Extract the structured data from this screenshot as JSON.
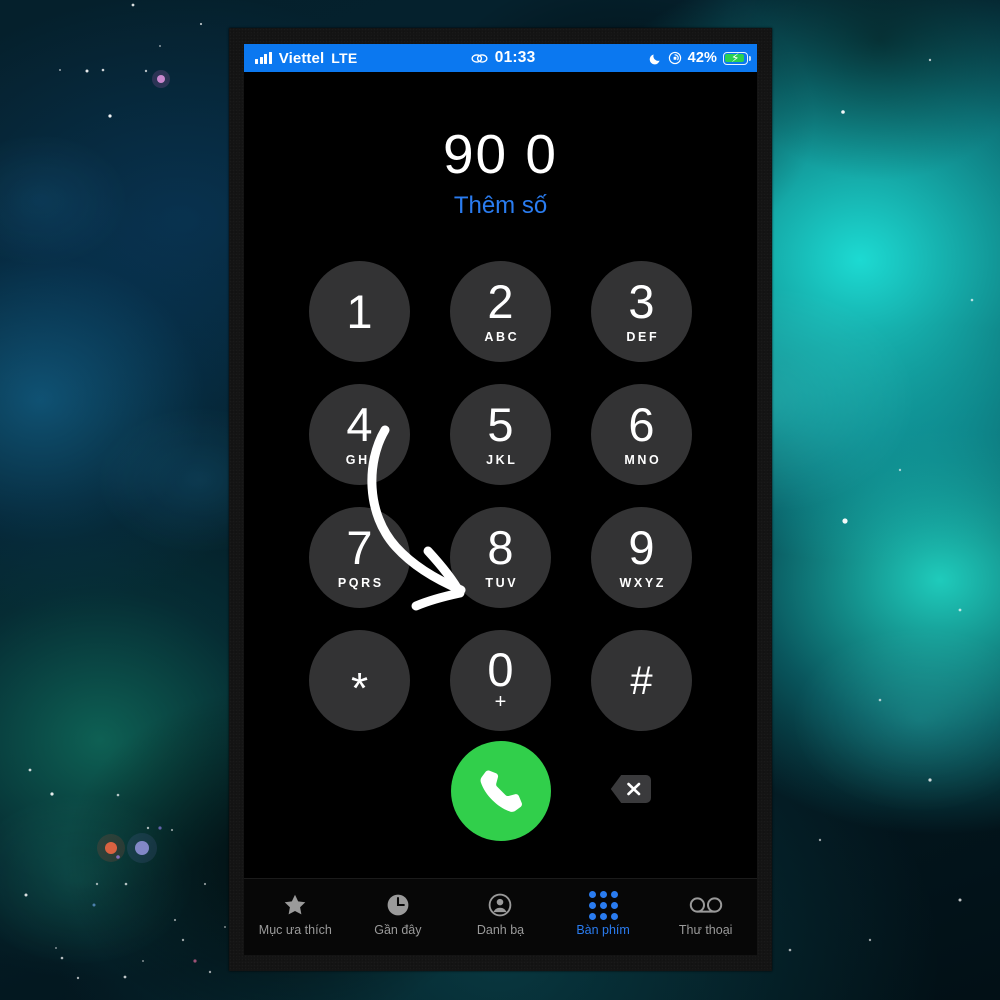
{
  "wallpaper": {
    "description": "space-nebula-wallpaper",
    "colors": {
      "teal": "#1ee4db",
      "deep_blue": "#05202c",
      "dark": "#021016"
    }
  },
  "phone": {
    "status_bar": {
      "signal_icon": "signal-bars-icon",
      "carrier": "Viettel",
      "network": "LTE",
      "link_icon": "link-icon",
      "time": "01:33",
      "dnd_icon": "moon-icon",
      "rotation_lock_icon": "rotation-lock-icon",
      "battery_percent": "42%",
      "battery_icon": "battery-charging-icon",
      "bg_color": "#0b78f0"
    },
    "dialer": {
      "number": "90 0",
      "add_number_label": "Thêm số",
      "add_number_color": "#2a7cf0",
      "keys": [
        {
          "digit": "1",
          "letters": ""
        },
        {
          "digit": "2",
          "letters": "ABC"
        },
        {
          "digit": "3",
          "letters": "DEF"
        },
        {
          "digit": "4",
          "letters": "GHI"
        },
        {
          "digit": "5",
          "letters": "JKL"
        },
        {
          "digit": "6",
          "letters": "MNO"
        },
        {
          "digit": "7",
          "letters": "PQRS"
        },
        {
          "digit": "8",
          "letters": "TUV"
        },
        {
          "digit": "9",
          "letters": "WXYZ"
        },
        {
          "digit": "*",
          "letters": ""
        },
        {
          "digit": "0",
          "letters": "+"
        },
        {
          "digit": "#",
          "letters": ""
        }
      ],
      "call_button": {
        "icon": "phone-handset-icon",
        "color": "#31cf4b"
      },
      "delete_button": {
        "icon": "backspace-delete-icon"
      }
    },
    "tab_bar": {
      "active_color": "#2a7cf0",
      "inactive_color": "#9a9a9a",
      "tabs": [
        {
          "label": "Mục ưa thích",
          "icon": "star-icon",
          "active": false
        },
        {
          "label": "Gần đây",
          "icon": "clock-icon",
          "active": false
        },
        {
          "label": "Danh bạ",
          "icon": "contact-person-icon",
          "active": false
        },
        {
          "label": "Bàn phím",
          "icon": "keypad-dots-icon",
          "active": true
        },
        {
          "label": "Thư thoại",
          "icon": "voicemail-icon",
          "active": false
        }
      ]
    },
    "annotation": {
      "type": "curved-arrow",
      "color": "#ffffff",
      "points_to": "call-button"
    }
  }
}
